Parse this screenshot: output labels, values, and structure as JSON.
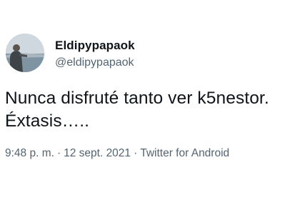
{
  "author": {
    "display_name": "Eldipypapaok",
    "handle": "@eldipypapaok",
    "avatar_icon": "profile-photo"
  },
  "tweet": {
    "line1": "Nunca disfruté tanto ver k5nestor.",
    "line2": "Éxtasis….."
  },
  "meta": {
    "time": "9:48 p. m.",
    "separator": "·",
    "date": "12 sept. 2021",
    "source": "Twitter for Android"
  },
  "colors": {
    "text_primary": "#0f1419",
    "text_secondary": "#536471",
    "background": "#ffffff"
  }
}
